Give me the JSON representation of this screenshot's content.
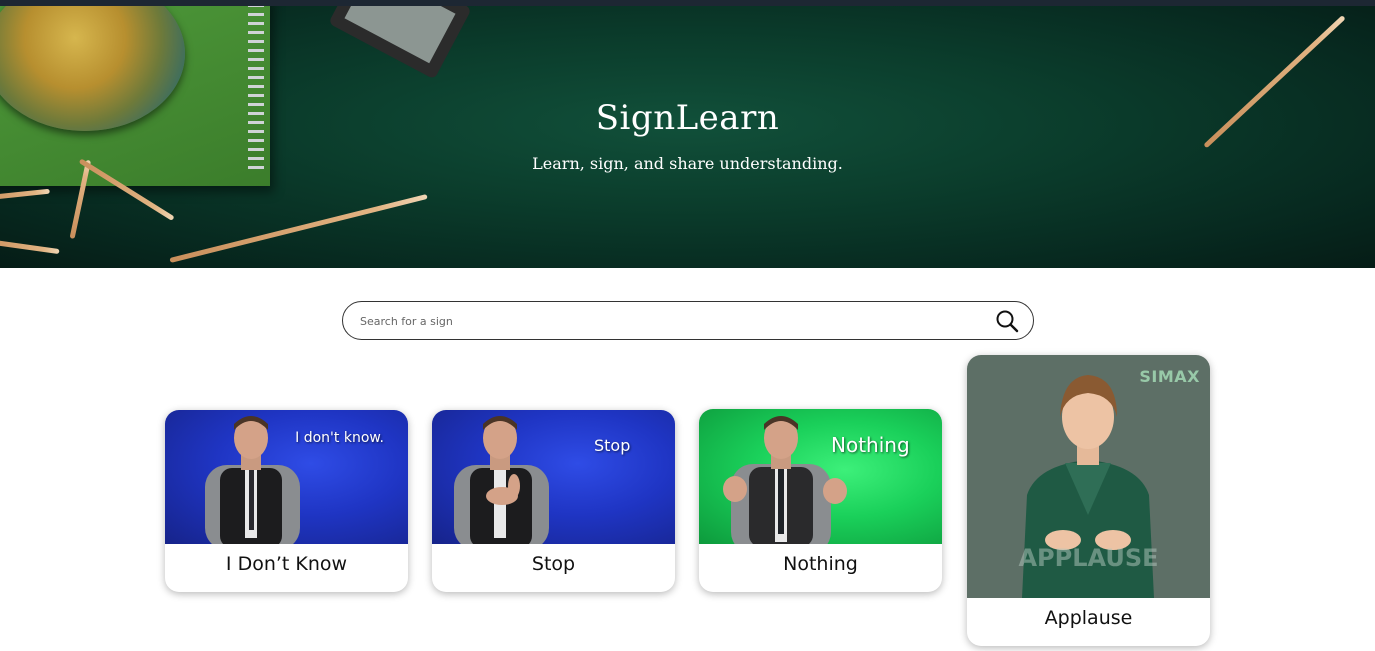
{
  "hero": {
    "title": "SignLearn",
    "subtitle": "Learn, sign, and share understanding."
  },
  "search": {
    "placeholder": "Search for a sign",
    "value": ""
  },
  "cards": [
    {
      "label": "I Don’t Know",
      "caption": "I don't know.",
      "background": "blue"
    },
    {
      "label": "Stop",
      "caption": "Stop",
      "background": "blue"
    },
    {
      "label": "Nothing",
      "caption": "Nothing",
      "background": "green"
    },
    {
      "label": "Applause",
      "watermark": "APPLAUSE",
      "brand": "SIMAX",
      "background": "gray"
    }
  ],
  "colors": {
    "hero_green": "#0b3d2c",
    "topbar": "#1d2733",
    "video_blue": "#1f35c4",
    "video_green": "#1ad05a",
    "avatar_bg": "#5d6f66"
  }
}
